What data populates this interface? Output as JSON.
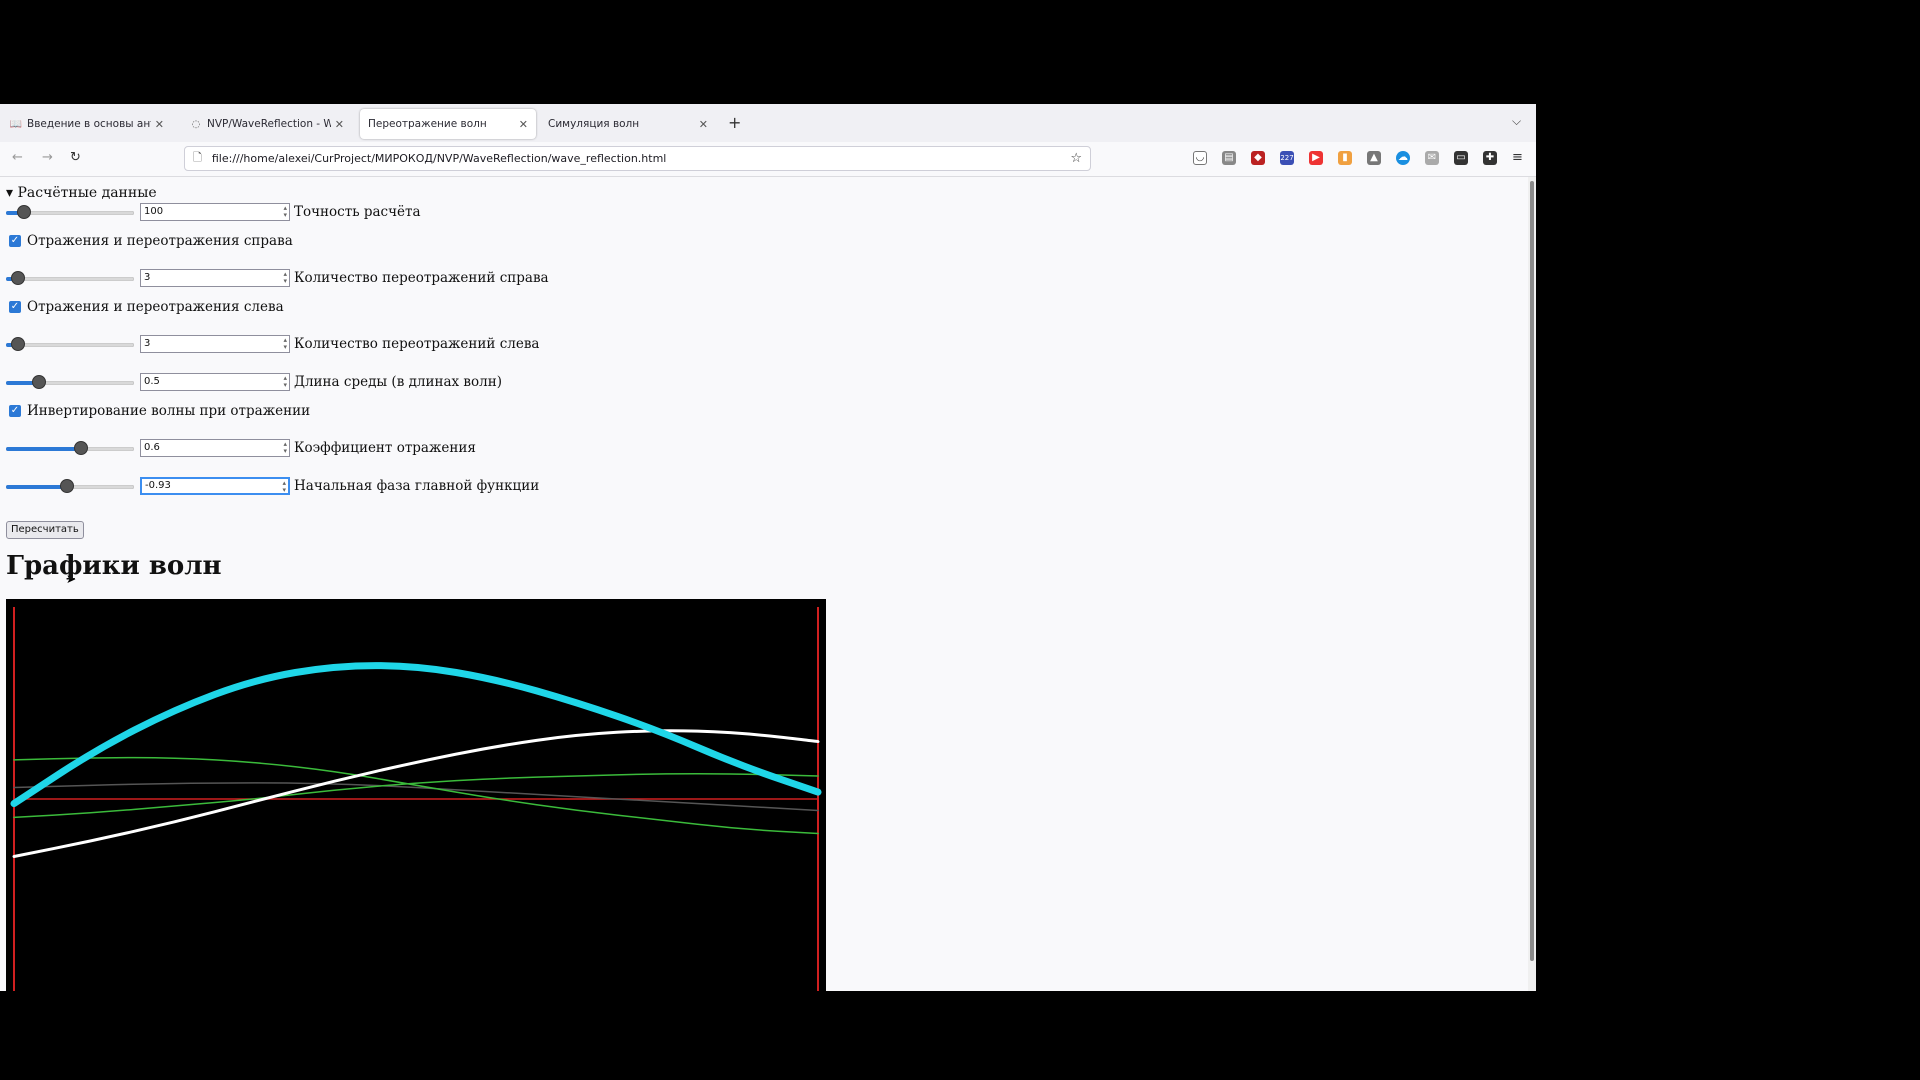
{
  "browser": {
    "tabs": [
      {
        "title": "Введение в основы антенн",
        "icon": "book-icon"
      },
      {
        "title": "NVP/WaveReflection - Wave",
        "icon": "loading-icon"
      },
      {
        "title": "Переотражение волн",
        "icon": ""
      },
      {
        "title": "Симуляция волн",
        "icon": ""
      }
    ],
    "url": "file:///home/alexei/CurProject/МИРОКОД/NVP/WaveReflection/wave_reflection.html",
    "extension_badge": "227"
  },
  "page": {
    "summary": "Расчётные данные",
    "controls": {
      "accuracy": {
        "value": "100",
        "label": "Точность расчёта",
        "fraction": 0.1
      },
      "right_reflections_cb": {
        "label": "Отражения и переотражения справа",
        "checked": true
      },
      "right_count": {
        "value": "3",
        "label": "Количество переотражений справа",
        "fraction": 0.04
      },
      "left_reflections_cb": {
        "label": "Отражения и переотражения слева",
        "checked": true
      },
      "left_count": {
        "value": "3",
        "label": "Количество переотражений слева",
        "fraction": 0.04
      },
      "medium_length": {
        "value": "0.5",
        "label": "Длина среды (в длинах волн)",
        "fraction": 0.23
      },
      "invert_cb": {
        "label": "Инвертирование волны при отражении",
        "checked": true
      },
      "reflection_coef": {
        "value": "0.6",
        "label": "Коэффициент отражения",
        "fraction": 0.6
      },
      "initial_phase": {
        "value": "-0.93",
        "label": "Начальная фаза главной функции",
        "fraction": 0.47
      }
    },
    "recalc_button": "Пересчитать",
    "heading": "Графики волн"
  },
  "chart_data": {
    "type": "line",
    "title": "",
    "xlabel": "",
    "ylabel": "",
    "background": "#000000",
    "xlim": [
      0,
      1
    ],
    "ylim": [
      -1,
      1
    ],
    "axis_color": "#d02020",
    "series": [
      {
        "color": "#1fd6e8",
        "width": "thick",
        "x": [
          0,
          0.1,
          0.2,
          0.3,
          0.4,
          0.5,
          0.6,
          0.7,
          0.8,
          0.9,
          1.0
        ],
        "y": [
          -0.02,
          0.21,
          0.39,
          0.52,
          0.58,
          0.58,
          0.52,
          0.42,
          0.3,
          0.15,
          0.03
        ]
      },
      {
        "color": "#ffffff",
        "width": "medium",
        "x": [
          0,
          0.1,
          0.2,
          0.3,
          0.4,
          0.5,
          0.6,
          0.7,
          0.8,
          0.9,
          1.0
        ],
        "y": [
          -0.25,
          -0.18,
          -0.1,
          -0.01,
          0.08,
          0.16,
          0.23,
          0.28,
          0.3,
          0.29,
          0.25
        ]
      },
      {
        "color": "#3bbb3b",
        "width": "thin",
        "x": [
          0,
          0.1,
          0.2,
          0.3,
          0.4,
          0.5,
          0.6,
          0.7,
          0.8,
          0.9,
          1.0
        ],
        "y": [
          0.17,
          0.18,
          0.18,
          0.16,
          0.12,
          0.06,
          0.0,
          -0.05,
          -0.09,
          -0.13,
          -0.15
        ]
      },
      {
        "color": "#3bbb3b",
        "width": "thin",
        "x": [
          0,
          0.1,
          0.2,
          0.3,
          0.4,
          0.5,
          0.6,
          0.7,
          0.8,
          0.9,
          1.0
        ],
        "y": [
          -0.08,
          -0.06,
          -0.03,
          0.0,
          0.04,
          0.07,
          0.09,
          0.1,
          0.11,
          0.11,
          0.1
        ]
      },
      {
        "color": "#555555",
        "width": "thin",
        "x": [
          0,
          0.2,
          0.4,
          0.6,
          0.8,
          1.0
        ],
        "y": [
          0.05,
          0.07,
          0.07,
          0.03,
          -0.01,
          -0.05
        ]
      }
    ]
  }
}
